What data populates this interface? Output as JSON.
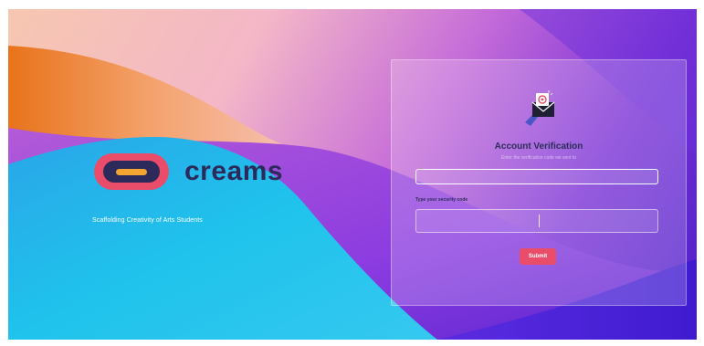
{
  "brand": {
    "name": "creams",
    "tagline": "Scaffolding Creativity of Arts Students",
    "colors": {
      "logo_outer": "#ea4d6a",
      "logo_inner": "#2b2a5b",
      "logo_bar": "#f2a531",
      "name": "#2b2a5b"
    }
  },
  "card": {
    "icon": "email-verification-icon",
    "title": "Account Verification",
    "subtitle": "Enter the verification code we sent to",
    "email_value": "",
    "email_placeholder": "",
    "code_label": "Type your security code",
    "code_value": "",
    "submit_label": "Submit"
  },
  "colors": {
    "submit": "#ea4d6a",
    "title": "#2d2e5a"
  }
}
